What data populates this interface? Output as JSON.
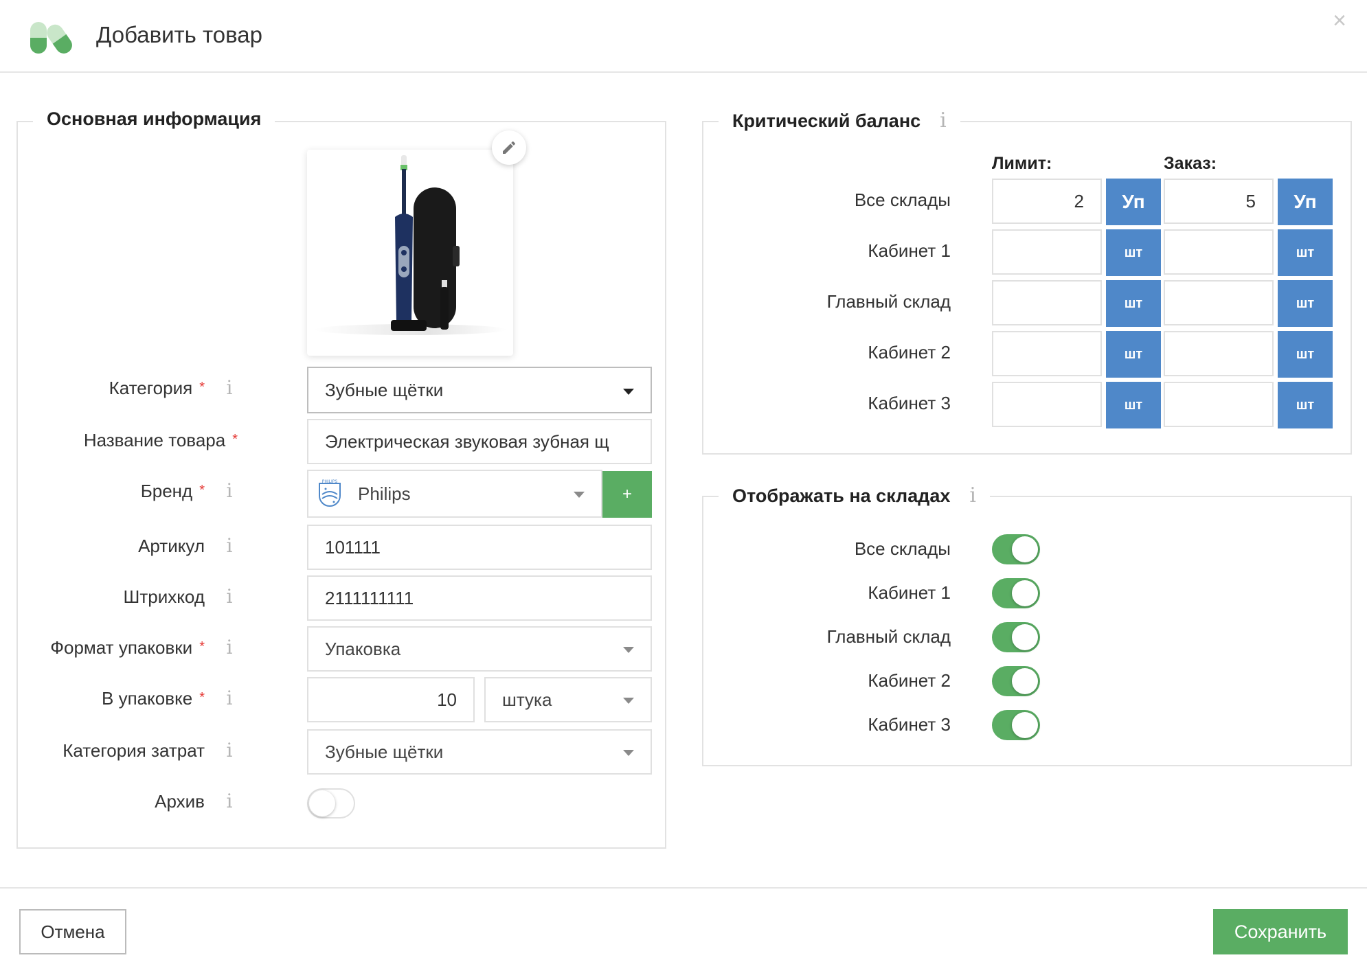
{
  "dialog": {
    "title": "Добавить товар",
    "close": "×"
  },
  "main_info": {
    "legend": "Основная информация",
    "fields": {
      "category": {
        "label": "Категория",
        "required": "*",
        "info": "i",
        "value": "Зубные щётки"
      },
      "name": {
        "label": "Название товара",
        "required": "*",
        "value": "Электрическая звуковая зубная щ"
      },
      "brand": {
        "label": "Бренд",
        "required": "*",
        "info": "i",
        "value": "Philips",
        "logo_text": "PHILIPS",
        "add": "+"
      },
      "article": {
        "label": "Артикул",
        "info": "i",
        "value": "101111"
      },
      "barcode": {
        "label": "Штрихкод",
        "info": "i",
        "value": "2111111111"
      },
      "pack_format": {
        "label": "Формат упаковки",
        "required": "*",
        "info": "i",
        "value": "Упаковка"
      },
      "in_pack": {
        "label": "В упаковке",
        "required": "*",
        "info": "i",
        "quantity": "10",
        "unit": "штука"
      },
      "cost_category": {
        "label": "Категория затрат",
        "info": "i",
        "value": "Зубные щётки"
      },
      "archive": {
        "label": "Архив",
        "info": "i",
        "enabled": false
      }
    }
  },
  "critical_balance": {
    "legend": "Критический баланс",
    "info": "i",
    "limit_header": "Лимит:",
    "order_header": "Заказ:",
    "rows": [
      {
        "label": "Все склады",
        "limit": "2",
        "limit_unit": "Уп",
        "order": "5",
        "order_unit": "Уп"
      },
      {
        "label": "Кабинет 1",
        "limit": "",
        "limit_unit": "шт",
        "order": "",
        "order_unit": "шт"
      },
      {
        "label": "Главный склад",
        "limit": "",
        "limit_unit": "шт",
        "order": "",
        "order_unit": "шт"
      },
      {
        "label": "Кабинет 2",
        "limit": "",
        "limit_unit": "шт",
        "order": "",
        "order_unit": "шт"
      },
      {
        "label": "Кабинет 3",
        "limit": "",
        "limit_unit": "шт",
        "order": "",
        "order_unit": "шт"
      }
    ]
  },
  "show_in_warehouses": {
    "legend": "Отображать на складах",
    "info": "i",
    "rows": [
      {
        "label": "Все склады",
        "enabled": true
      },
      {
        "label": "Кабинет 1",
        "enabled": true
      },
      {
        "label": "Главный склад",
        "enabled": true
      },
      {
        "label": "Кабинет 2",
        "enabled": true
      },
      {
        "label": "Кабинет 3",
        "enabled": true
      }
    ]
  },
  "footer": {
    "cancel": "Отмена",
    "save": "Сохранить"
  },
  "colors": {
    "green": "#5aad63",
    "blue": "#4f88c9",
    "required": "#e53935"
  },
  "icons": {
    "edit": "pencil-icon",
    "close": "close-icon",
    "info": "info-icon",
    "dropdown": "caret-down-icon"
  }
}
